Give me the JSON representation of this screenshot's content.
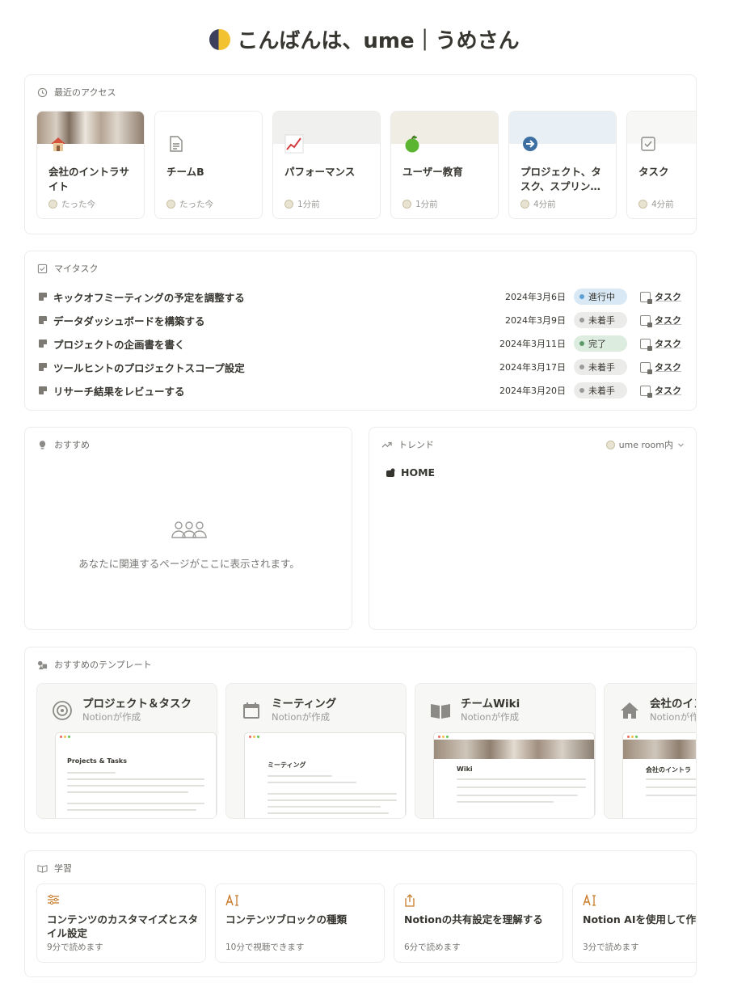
{
  "greeting": {
    "text": "こんばんは、ume｜うめさん"
  },
  "recent": {
    "heading": "最近のアクセス",
    "items": [
      {
        "title": "会社のイントラサイト",
        "time": "たった今",
        "icon": "house-icon"
      },
      {
        "title": "チームB",
        "time": "たった今",
        "icon": "document-icon"
      },
      {
        "title": "パフォーマンス",
        "time": "1分前",
        "icon": "chart-up-icon"
      },
      {
        "title": "ユーザー教育",
        "time": "1分前",
        "icon": "apple-icon"
      },
      {
        "title": "プロジェクト、タスク、スプリン…",
        "time": "4分前",
        "icon": "arrow-right-circle-icon"
      },
      {
        "title": "タスク",
        "time": "4分前",
        "icon": "checkbox-icon"
      }
    ]
  },
  "tasks": {
    "heading": "マイタスク",
    "link_label": "タスク",
    "items": [
      {
        "name": "キックオフミーティングの予定を調整する",
        "date": "2024年3月6日",
        "status": "進行中"
      },
      {
        "name": "データダッシュボードを構築する",
        "date": "2024年3月9日",
        "status": "未着手"
      },
      {
        "name": "プロジェクトの企画書を書く",
        "date": "2024年3月11日",
        "status": "完了"
      },
      {
        "name": "ツールヒントのプロジェクトスコープ設定",
        "date": "2024年3月17日",
        "status": "未着手"
      },
      {
        "name": "リサーチ結果をレビューする",
        "date": "2024年3月20日",
        "status": "未着手"
      }
    ],
    "status_colors": {
      "進行中": {
        "bg": "#d9e8f5",
        "dot": "#5e9fd4"
      },
      "未着手": {
        "bg": "#ebebea",
        "dot": "#9b9a97"
      },
      "完了": {
        "bg": "#dcecdf",
        "dot": "#5c9a6c"
      }
    }
  },
  "recommend": {
    "heading": "おすすめ",
    "empty_text": "あなたに関連するページがここに表示されます。"
  },
  "trend": {
    "heading": "トレンド",
    "room": "ume room内",
    "item": "HOME"
  },
  "templates": {
    "heading": "おすすめのテンプレート",
    "items": [
      {
        "title": "プロジェクト＆タスク",
        "subtitle": "Notionが作成",
        "icon": "target-icon",
        "preview_title": "Projects & Tasks"
      },
      {
        "title": "ミーティング",
        "subtitle": "Notionが作成",
        "icon": "calendar-icon",
        "preview_title": "ミーティング"
      },
      {
        "title": "チームWiki",
        "subtitle": "Notionが作成",
        "icon": "book-icon",
        "preview_title": "Wiki"
      },
      {
        "title": "会社のイン",
        "subtitle": "Notionが作",
        "icon": "house-icon",
        "preview_title": "会社のイントラ"
      }
    ]
  },
  "learn": {
    "heading": "学習",
    "items": [
      {
        "title": "コンテンツのカスタマイズとスタイル設定",
        "meta": "9分で読めます",
        "icon": "sliders-icon"
      },
      {
        "title": "コンテンツブロックの種類",
        "meta": "10分で視聴できます",
        "icon": "text-cursor-icon"
      },
      {
        "title": "Notionの共有設定を理解する",
        "meta": "6分で読めます",
        "icon": "share-icon"
      },
      {
        "title": "Notion AIを使用して作業アップ",
        "meta": "3分で読めます",
        "icon": "text-cursor-icon"
      }
    ]
  }
}
